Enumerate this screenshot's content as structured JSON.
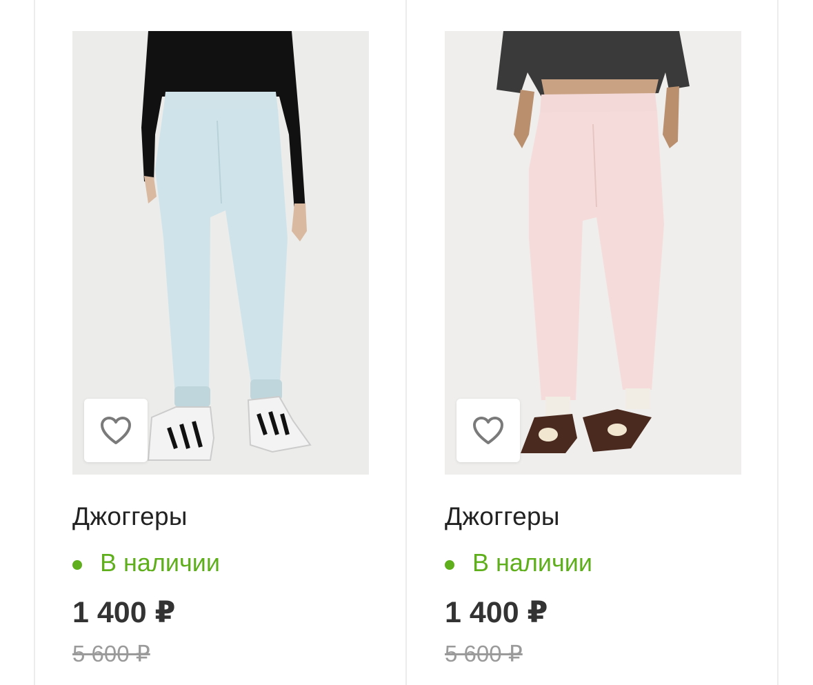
{
  "products": [
    {
      "title": "Джоггеры",
      "availability": "В наличии",
      "price": "1 400 ₽",
      "old_price": "5 600 ₽",
      "favorite_icon": "heart-icon",
      "image_subject": "light-blue jogger pants"
    },
    {
      "title": "Джоггеры",
      "availability": "В наличии",
      "price": "1 400 ₽",
      "old_price": "5 600 ₽",
      "favorite_icon": "heart-icon",
      "image_subject": "pale-pink jogger pants"
    }
  ],
  "colors": {
    "availability": "#5fae1c",
    "price": "#333333",
    "old_price": "#9a9a9a",
    "title": "#222222"
  }
}
